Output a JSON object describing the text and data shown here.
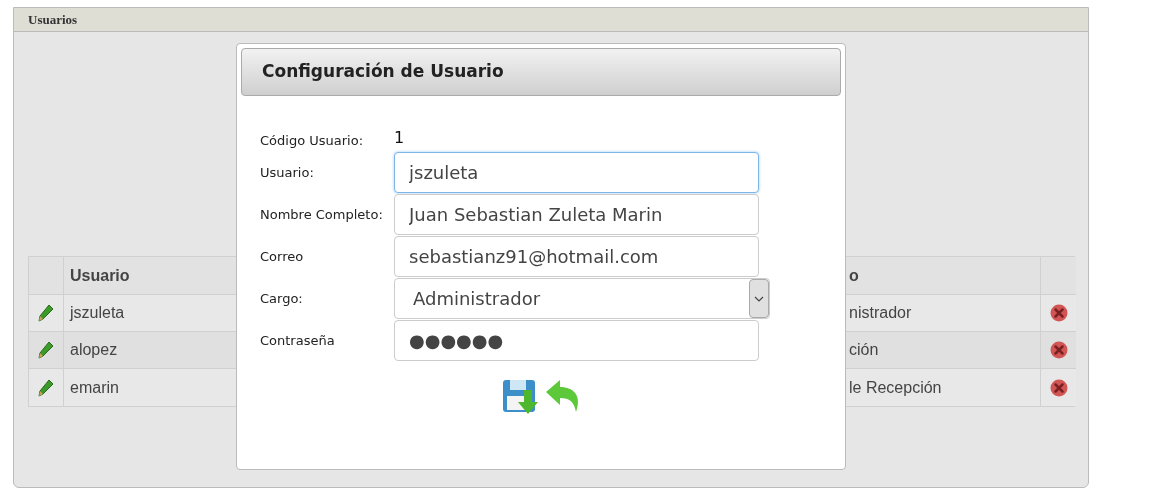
{
  "panel": {
    "title": "Usuarios"
  },
  "table": {
    "columns": [
      "Usuario",
      "o"
    ],
    "rows": [
      {
        "usuario": "jszuleta",
        "column_3": "nistrador"
      },
      {
        "usuario": "alopez",
        "column_3": "ción"
      },
      {
        "usuario": "emarin",
        "column_3": "le Recepción"
      }
    ]
  },
  "dialog": {
    "title": "Configuración de Usuario",
    "code": {
      "label": "Código Usuario:",
      "value": "1"
    },
    "fields": [
      {
        "kind": "text",
        "label": "Usuario:",
        "value": "jszuleta",
        "focused": true
      },
      {
        "kind": "text",
        "label": "Nombre Completo:",
        "value": "Juan Sebastian Zuleta Marin",
        "focused": false
      },
      {
        "kind": "text",
        "label": "Correo",
        "value": "sebastianz91@hotmail.com",
        "focused": false
      },
      {
        "kind": "select",
        "label": "Cargo:",
        "value": "Administrador",
        "focused": false
      },
      {
        "kind": "password",
        "label": "Contraseña",
        "value": "●●●●●●",
        "focused": false
      }
    ]
  }
}
